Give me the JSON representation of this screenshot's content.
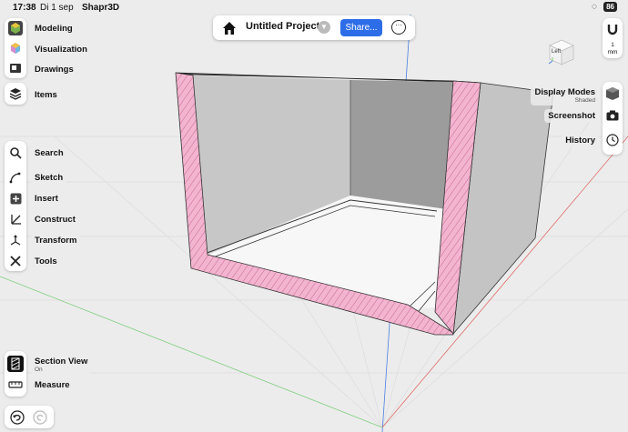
{
  "status_bar": {
    "time": "17:38",
    "date": "Di 1 sep",
    "app_name": "Shapr3D",
    "battery": "86"
  },
  "top_bar": {
    "project_title": "Untitled Project",
    "share_label": "Share..."
  },
  "left_toolbar": {
    "workspaces": [
      {
        "label": "Modeling",
        "icon": "modeling-icon"
      },
      {
        "label": "Visualization",
        "icon": "visualization-icon"
      },
      {
        "label": "Drawings",
        "icon": "drawings-icon"
      }
    ],
    "items_label": "Items",
    "tools": [
      {
        "label": "Search",
        "icon": "search-icon"
      },
      {
        "label": "Sketch",
        "icon": "sketch-icon"
      },
      {
        "label": "Insert",
        "icon": "insert-icon"
      },
      {
        "label": "Construct",
        "icon": "construct-icon"
      },
      {
        "label": "Transform",
        "icon": "transform-icon"
      },
      {
        "label": "Tools",
        "icon": "tools-icon"
      }
    ],
    "section_view": {
      "label": "Section View",
      "state": "On"
    },
    "measure_label": "Measure"
  },
  "right_toolbar": {
    "view_cube_label": "Left",
    "units": {
      "value": "1",
      "unit": "mm"
    },
    "display_modes": {
      "label": "Display Modes",
      "value": "Shaded"
    },
    "screenshot_label": "Screenshot",
    "history_label": "History"
  },
  "colors": {
    "accent": "#2e6de8",
    "section_fill": "#f3b4cf",
    "section_hatch": "#c56a94"
  }
}
